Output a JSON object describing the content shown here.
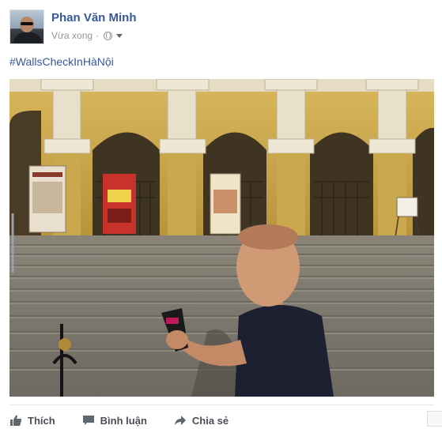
{
  "post": {
    "author": {
      "name": "Phan Văn Minh",
      "avatar_icon": "user-avatar-photo"
    },
    "timestamp": "Vừa xong",
    "privacy_icon": "globe-icon",
    "audience_menu_icon": "caret-down-icon",
    "hashtag": "#WallsCheckInHàNội",
    "photo": {
      "description_icon": "photo-man-with-ice-cream-at-opera-house",
      "poster_texts": []
    }
  },
  "actions": {
    "like_label": "Thích",
    "comment_label": "Bình luận",
    "share_label": "Chia sẻ"
  },
  "colors": {
    "link": "#365899",
    "meta": "#90949c",
    "action_text": "#4b4f56"
  }
}
